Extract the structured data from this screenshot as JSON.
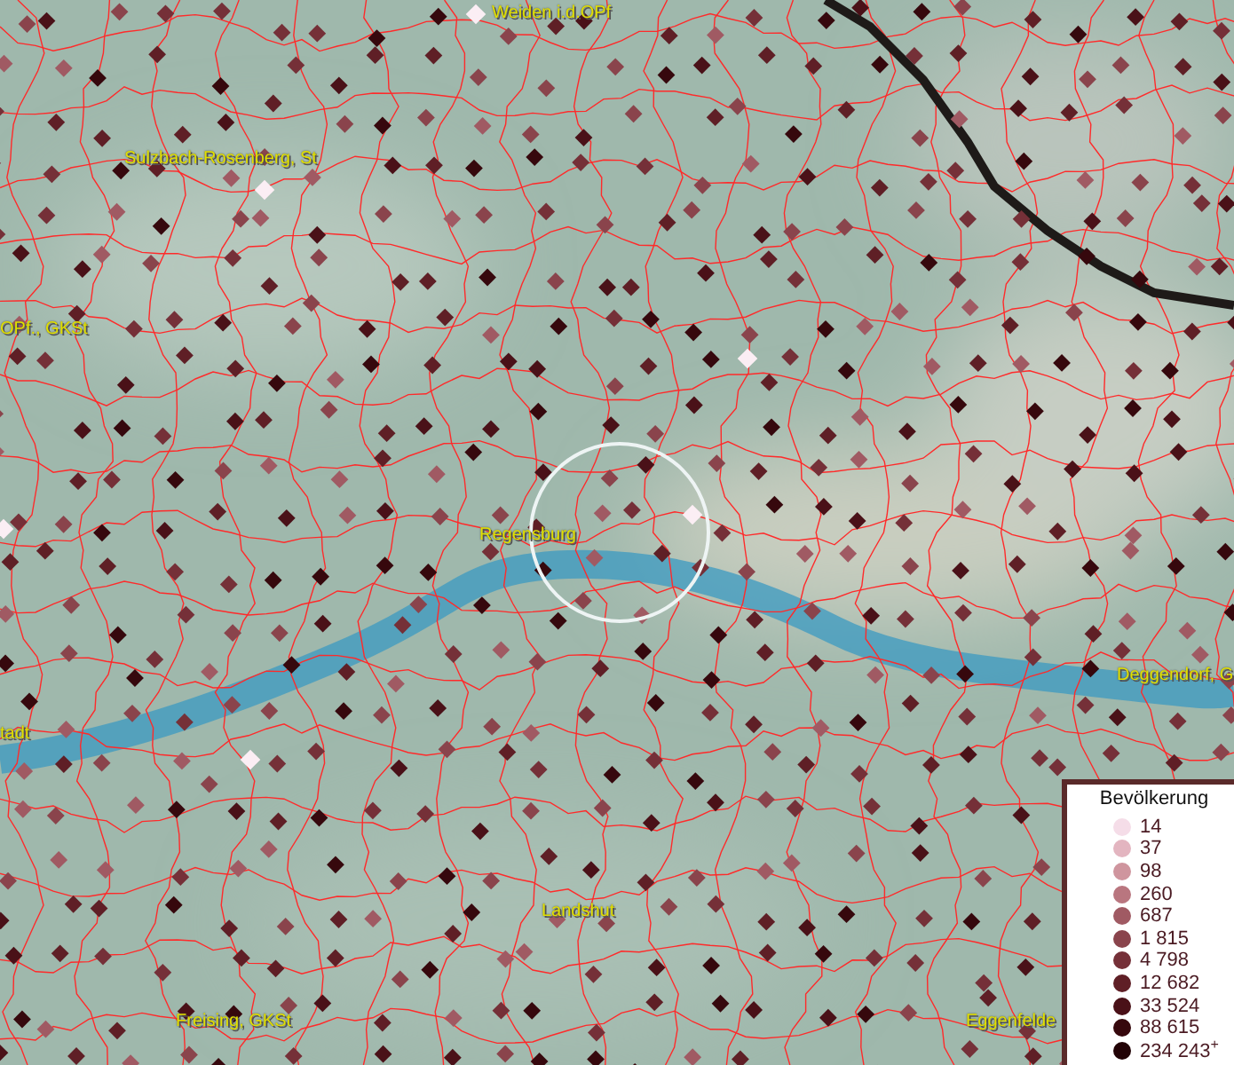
{
  "map": {
    "places": [
      {
        "name": "Weiden i.d.OPf"
      },
      {
        "name": "Sulzbach-Rosenberg, St"
      },
      {
        "name": "OPf., GKSt"
      },
      {
        "name": "Regensburg"
      },
      {
        "name": "Deggendorf, G"
      },
      {
        "name": "tadt"
      },
      {
        "name": "Landshut"
      },
      {
        "name": "Freising, GKSt"
      },
      {
        "name": "Eggenfelde"
      }
    ]
  },
  "legend": {
    "title": "Bevölkerung",
    "entries": [
      {
        "label": "14",
        "color": "#f5dde8"
      },
      {
        "label": "37",
        "color": "#e3b5c0"
      },
      {
        "label": "98",
        "color": "#cf959e"
      },
      {
        "label": "260",
        "color": "#b9767f"
      },
      {
        "label": "687",
        "color": "#a05a63"
      },
      {
        "label": "1 815",
        "color": "#8a444c"
      },
      {
        "label": "4 798",
        "color": "#753038"
      },
      {
        "label": "12 682",
        "color": "#5f1f26"
      },
      {
        "label": "33 524",
        "color": "#4a1118"
      },
      {
        "label": "88 615",
        "color": "#36080d"
      },
      {
        "label": "234 243$^{+}$",
        "color": "#220306"
      }
    ]
  }
}
